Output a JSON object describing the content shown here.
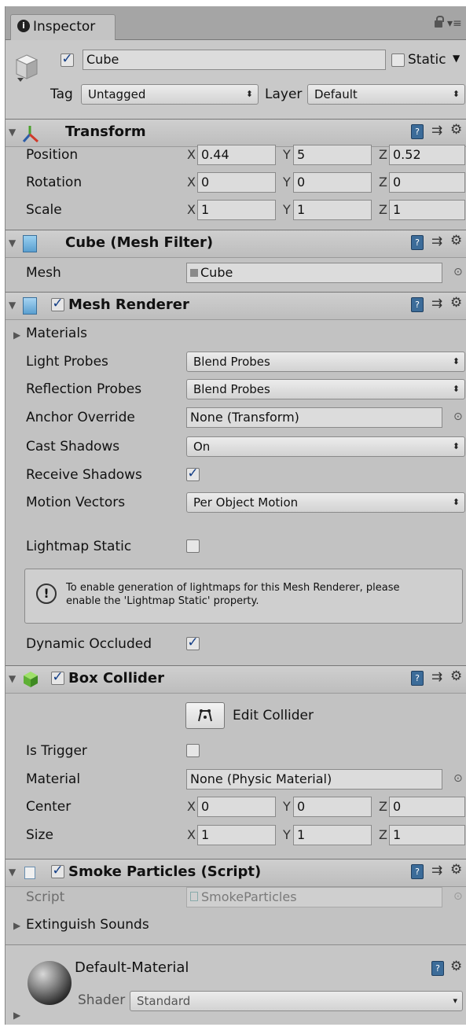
{
  "tab": {
    "label": "Inspector"
  },
  "object": {
    "name": "Cube",
    "active": "✓",
    "static_label": "Static",
    "tag_label": "Tag",
    "tag_value": "Untagged",
    "layer_label": "Layer",
    "layer_value": "Default"
  },
  "transform": {
    "title": "Transform",
    "position": {
      "label": "Position",
      "x": "0.44",
      "y": "5",
      "z": "0.52"
    },
    "rotation": {
      "label": "Rotation",
      "x": "0",
      "y": "0",
      "z": "0"
    },
    "scale": {
      "label": "Scale",
      "x": "1",
      "y": "1",
      "z": "1"
    }
  },
  "axes": {
    "x": "X",
    "y": "Y",
    "z": "Z"
  },
  "mesh_filter": {
    "title": "Cube (Mesh Filter)",
    "mesh_label": "Mesh",
    "mesh_value": "Cube"
  },
  "mesh_renderer": {
    "title": "Mesh Renderer",
    "enabled": "✓",
    "materials_label": "Materials",
    "light_probes_label": "Light Probes",
    "light_probes_value": "Blend Probes",
    "reflection_probes_label": "Reflection Probes",
    "reflection_probes_value": "Blend Probes",
    "anchor_override_label": "Anchor Override",
    "anchor_override_value": "None (Transform)",
    "cast_shadows_label": "Cast Shadows",
    "cast_shadows_value": "On",
    "receive_shadows_label": "Receive Shadows",
    "receive_shadows_value": "✓",
    "motion_vectors_label": "Motion Vectors",
    "motion_vectors_value": "Per Object Motion",
    "lightmap_static_label": "Lightmap Static",
    "lightmap_static_value": "",
    "info_line1": "To enable generation of lightmaps for this Mesh Renderer, please",
    "info_line2": "enable the 'Lightmap Static' property.",
    "dynamic_occluded_label": "Dynamic Occluded",
    "dynamic_occluded_value": "✓"
  },
  "box_collider": {
    "title": "Box Collider",
    "enabled": "✓",
    "edit_collider_label": "Edit Collider",
    "is_trigger_label": "Is Trigger",
    "is_trigger_value": "",
    "material_label": "Material",
    "material_value": "None (Physic Material)",
    "center": {
      "label": "Center",
      "x": "0",
      "y": "0",
      "z": "0"
    },
    "size": {
      "label": "Size",
      "x": "1",
      "y": "1",
      "z": "1"
    }
  },
  "smoke_particles": {
    "title": "Smoke Particles (Script)",
    "enabled": "✓",
    "script_label": "Script",
    "script_value": "SmokeParticles",
    "extinguish_label": "Extinguish Sounds"
  },
  "material": {
    "name": "Default-Material",
    "shader_label": "Shader",
    "shader_value": "Standard"
  },
  "icons": {
    "info": "info-icon",
    "lock": "lock-icon",
    "menu": "menu-icon",
    "book": "help-book-icon",
    "sliders": "preset-sliders-icon",
    "gear": "gear-icon",
    "target": "object-picker-icon"
  },
  "colors": {
    "panel_bg": "#c2c2c2",
    "header_bg": "#bdbdbd",
    "field_bg": "#dcdcdc",
    "checkmark": "#143e86"
  }
}
